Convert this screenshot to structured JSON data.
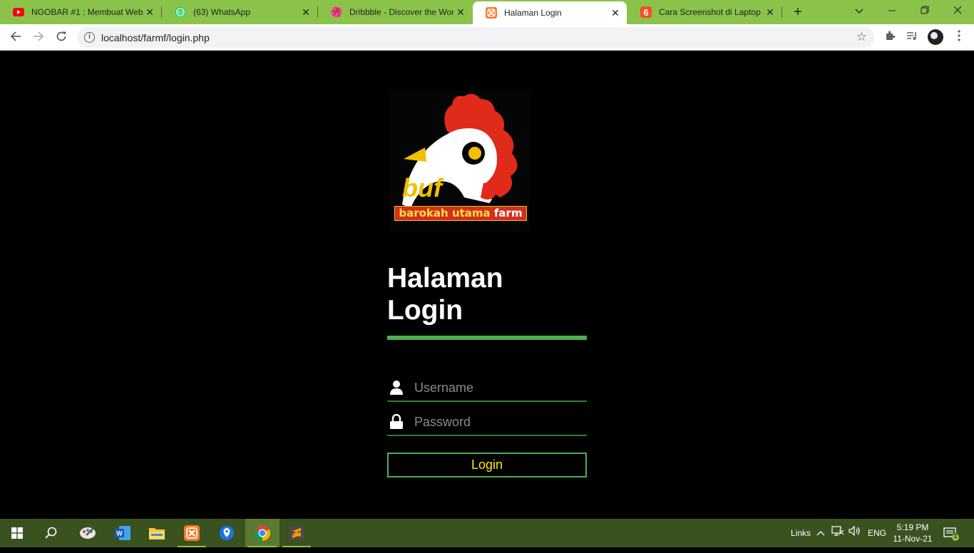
{
  "browser": {
    "tabs": [
      {
        "title": "NGOBAR #1 : Membuat Web",
        "icon": "youtube-icon",
        "active": false
      },
      {
        "title": "(63) WhatsApp",
        "icon": "whatsapp-icon",
        "badge": "63",
        "active": false
      },
      {
        "title": "Dribbble - Discover the World",
        "icon": "dribbble-icon",
        "active": false
      },
      {
        "title": "Halaman Login",
        "icon": "xampp-icon",
        "active": true
      },
      {
        "title": "Cara Screenshot di Laptop A",
        "icon": "tab-six-icon",
        "badge": "6",
        "active": false
      }
    ],
    "new_tab": "+",
    "url": "localhost/farmf/login.php"
  },
  "logo": {
    "brand": "buf",
    "banner_main": "barokah utama ",
    "banner_accent": "farm",
    "colors": {
      "comb": "#e02a1a",
      "head": "#ffffff",
      "brand": "#f0c000",
      "banner": "#d32f1f"
    }
  },
  "login": {
    "title_line1": "Halaman",
    "title_line2": "Login",
    "username_placeholder": "Username",
    "password_placeholder": "Password",
    "button": "Login",
    "colors": {
      "accent": "#4caf50",
      "button_text": "#ffeb00"
    }
  },
  "taskbar": {
    "links": "Links",
    "language": "ENG",
    "time": "5:19 PM",
    "date": "11-Nov-21",
    "notifications": "1"
  }
}
